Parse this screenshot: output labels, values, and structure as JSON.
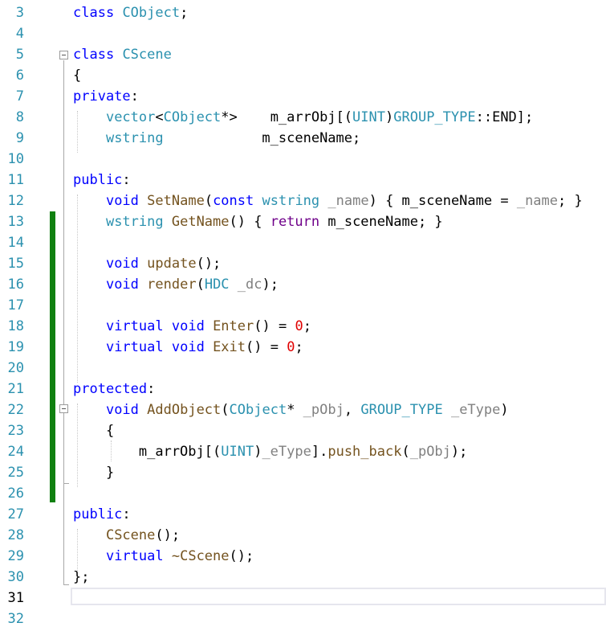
{
  "editor": {
    "line_numbers": [
      "3",
      "4",
      "5",
      "6",
      "7",
      "8",
      "9",
      "10",
      "11",
      "12",
      "13",
      "14",
      "15",
      "16",
      "17",
      "18",
      "19",
      "20",
      "21",
      "22",
      "23",
      "24",
      "25",
      "26",
      "27",
      "28",
      "29",
      "30",
      "31",
      "32"
    ],
    "current_line": "31",
    "colors": {
      "keyword": "#0000ff",
      "type": "#2b91af",
      "function": "#74531f",
      "parameter": "#808080",
      "number": "#e00000",
      "return_keyword": "#6f008a",
      "change_bar": "#108010"
    },
    "lines": [
      {
        "n": "3",
        "tokens": [
          [
            "kw",
            "class"
          ],
          [
            "",
            " "
          ],
          [
            "ty",
            "CObject"
          ],
          [
            "",
            ";"
          ]
        ]
      },
      {
        "n": "4",
        "tokens": []
      },
      {
        "n": "5",
        "tokens": [
          [
            "kw",
            "class"
          ],
          [
            "",
            " "
          ],
          [
            "ty",
            "CScene"
          ]
        ]
      },
      {
        "n": "6",
        "tokens": [
          [
            "",
            "{"
          ]
        ]
      },
      {
        "n": "7",
        "tokens": [
          [
            "kw",
            "private"
          ],
          [
            "",
            ":"
          ]
        ]
      },
      {
        "n": "8",
        "tokens": [
          [
            "",
            "    "
          ],
          [
            "ty",
            "vector"
          ],
          [
            "",
            "<"
          ],
          [
            "ty",
            "CObject"
          ],
          [
            "",
            "*>    m_arrObj[("
          ],
          [
            "ty",
            "UINT"
          ],
          [
            "",
            ")"
          ],
          [
            "ty",
            "GROUP_TYPE"
          ],
          [
            "",
            "::END];"
          ]
        ]
      },
      {
        "n": "9",
        "tokens": [
          [
            "",
            "    "
          ],
          [
            "ty",
            "wstring"
          ],
          [
            "",
            "            m_sceneName;"
          ]
        ]
      },
      {
        "n": "10",
        "tokens": []
      },
      {
        "n": "11",
        "tokens": [
          [
            "kw",
            "public"
          ],
          [
            "",
            ":"
          ]
        ]
      },
      {
        "n": "12",
        "tokens": [
          [
            "",
            "    "
          ],
          [
            "kw",
            "void"
          ],
          [
            "",
            " "
          ],
          [
            "fn",
            "SetName"
          ],
          [
            "",
            "("
          ],
          [
            "kw",
            "const"
          ],
          [
            "",
            " "
          ],
          [
            "ty",
            "wstring"
          ],
          [
            "",
            " "
          ],
          [
            "pm",
            "_name"
          ],
          [
            "",
            ") { m_sceneName = "
          ],
          [
            "pm",
            "_name"
          ],
          [
            "",
            "; }"
          ]
        ]
      },
      {
        "n": "13",
        "tokens": [
          [
            "",
            "    "
          ],
          [
            "ty",
            "wstring"
          ],
          [
            "",
            " "
          ],
          [
            "fn",
            "GetName"
          ],
          [
            "",
            "() { "
          ],
          [
            "mac",
            "return"
          ],
          [
            "",
            " m_sceneName; }"
          ]
        ]
      },
      {
        "n": "14",
        "tokens": []
      },
      {
        "n": "15",
        "tokens": [
          [
            "",
            "    "
          ],
          [
            "kw",
            "void"
          ],
          [
            "",
            " "
          ],
          [
            "fn",
            "update"
          ],
          [
            "",
            "();"
          ]
        ]
      },
      {
        "n": "16",
        "tokens": [
          [
            "",
            "    "
          ],
          [
            "kw",
            "void"
          ],
          [
            "",
            " "
          ],
          [
            "fn",
            "render"
          ],
          [
            "",
            "("
          ],
          [
            "ty",
            "HDC"
          ],
          [
            "",
            " "
          ],
          [
            "pm",
            "_dc"
          ],
          [
            "",
            ");"
          ]
        ]
      },
      {
        "n": "17",
        "tokens": []
      },
      {
        "n": "18",
        "tokens": [
          [
            "",
            "    "
          ],
          [
            "kw",
            "virtual"
          ],
          [
            "",
            " "
          ],
          [
            "kw",
            "void"
          ],
          [
            "",
            " "
          ],
          [
            "fn",
            "Enter"
          ],
          [
            "",
            "() = "
          ],
          [
            "num",
            "0"
          ],
          [
            "",
            ";"
          ]
        ]
      },
      {
        "n": "19",
        "tokens": [
          [
            "",
            "    "
          ],
          [
            "kw",
            "virtual"
          ],
          [
            "",
            " "
          ],
          [
            "kw",
            "void"
          ],
          [
            "",
            " "
          ],
          [
            "fn",
            "Exit"
          ],
          [
            "",
            "() = "
          ],
          [
            "num",
            "0"
          ],
          [
            "",
            ";"
          ]
        ]
      },
      {
        "n": "20",
        "tokens": []
      },
      {
        "n": "21",
        "tokens": [
          [
            "kw",
            "protected"
          ],
          [
            "",
            ":"
          ]
        ]
      },
      {
        "n": "22",
        "tokens": [
          [
            "",
            "    "
          ],
          [
            "kw",
            "void"
          ],
          [
            "",
            " "
          ],
          [
            "fn",
            "AddObject"
          ],
          [
            "",
            "("
          ],
          [
            "ty",
            "CObject"
          ],
          [
            "",
            "* "
          ],
          [
            "pm",
            "_pObj"
          ],
          [
            "",
            ", "
          ],
          [
            "ty",
            "GROUP_TYPE"
          ],
          [
            "",
            " "
          ],
          [
            "pm",
            "_eType"
          ],
          [
            "",
            ")"
          ]
        ]
      },
      {
        "n": "23",
        "tokens": [
          [
            "",
            "    {"
          ]
        ]
      },
      {
        "n": "24",
        "tokens": [
          [
            "",
            "        m_arrObj[("
          ],
          [
            "ty",
            "UINT"
          ],
          [
            "",
            ")"
          ],
          [
            "pm",
            "_eType"
          ],
          [
            "",
            "]."
          ],
          [
            "fn",
            "push_back"
          ],
          [
            "",
            "("
          ],
          [
            "pm",
            "_pObj"
          ],
          [
            "",
            ");"
          ]
        ]
      },
      {
        "n": "25",
        "tokens": [
          [
            "",
            "    }"
          ]
        ]
      },
      {
        "n": "26",
        "tokens": []
      },
      {
        "n": "27",
        "tokens": [
          [
            "kw",
            "public"
          ],
          [
            "",
            ":"
          ]
        ]
      },
      {
        "n": "28",
        "tokens": [
          [
            "",
            "    "
          ],
          [
            "fn",
            "CScene"
          ],
          [
            "",
            "();"
          ]
        ]
      },
      {
        "n": "29",
        "tokens": [
          [
            "",
            "    "
          ],
          [
            "kw",
            "virtual"
          ],
          [
            "",
            " "
          ],
          [
            "fn",
            "~CScene"
          ],
          [
            "",
            "();"
          ]
        ]
      },
      {
        "n": "30",
        "tokens": [
          [
            "",
            "};"
          ]
        ]
      },
      {
        "n": "31",
        "tokens": []
      },
      {
        "n": "32",
        "tokens": []
      }
    ]
  }
}
